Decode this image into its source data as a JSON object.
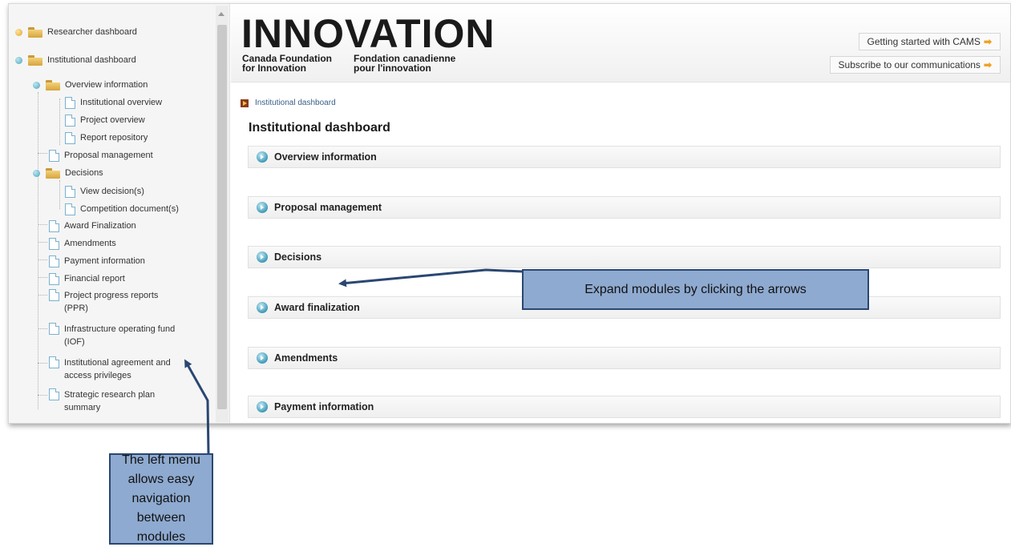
{
  "sidebar": {
    "items": [
      {
        "label": "Researcher dashboard"
      },
      {
        "label": "Institutional dashboard"
      },
      {
        "label": "Overview information"
      },
      {
        "label": "Institutional overview"
      },
      {
        "label": "Project overview"
      },
      {
        "label": "Report repository"
      },
      {
        "label": "Proposal management"
      },
      {
        "label": "Decisions"
      },
      {
        "label": "View decision(s)"
      },
      {
        "label": "Competition document(s)"
      },
      {
        "label": "Award Finalization"
      },
      {
        "label": "Amendments"
      },
      {
        "label": "Payment information"
      },
      {
        "label": "Financial report"
      },
      {
        "label": "Project progress reports (PPR)"
      },
      {
        "label": "Infrastructure operating fund (IOF)"
      },
      {
        "label": "Institutional agreement and access privileges"
      },
      {
        "label": "Strategic research plan summary"
      }
    ]
  },
  "header": {
    "logo_word": "INNOVATION",
    "logo_en": "Canada Foundation\nfor Innovation",
    "logo_fr": "Fondation canadienne\npour l'innovation",
    "btn_getting_started": "Getting started with CAMS",
    "btn_subscribe": "Subscribe to our communications"
  },
  "main": {
    "breadcrumb": "Institutional dashboard",
    "title": "Institutional dashboard",
    "modules": [
      {
        "label": "Overview information"
      },
      {
        "label": "Proposal management"
      },
      {
        "label": "Decisions"
      },
      {
        "label": "Award finalization"
      },
      {
        "label": "Amendments"
      },
      {
        "label": "Payment information"
      }
    ]
  },
  "callouts": {
    "modules": "Expand modules by clicking the arrows",
    "left_menu": "The left menu allows easy navigation between modules"
  },
  "colors": {
    "callout_fill": "#8eaad0",
    "callout_border": "#2a4772",
    "expand_icon": "#3e9ab8"
  }
}
